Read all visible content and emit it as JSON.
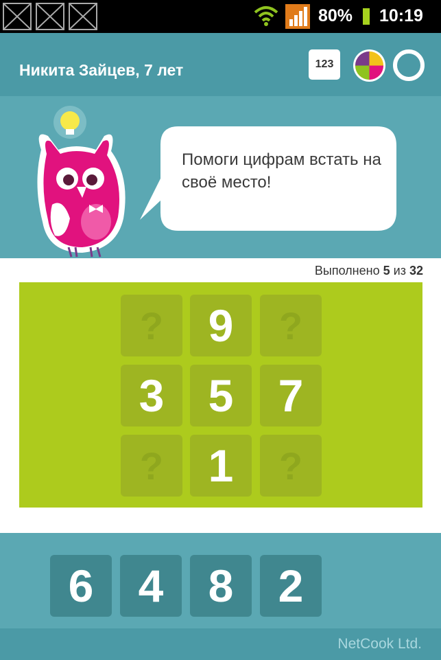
{
  "status_bar": {
    "battery": "80%",
    "time": "10:19"
  },
  "app_bar": {
    "profile_name": "Никита Зайцев, 7 лет",
    "numbers_button": "123"
  },
  "hero": {
    "speech": "Помоги цифрам встать на своё место!"
  },
  "progress": {
    "prefix": "Выполнено",
    "done": "5",
    "separator": "из",
    "total": "32"
  },
  "board": {
    "cells": [
      {
        "value": "?",
        "hidden": true
      },
      {
        "value": "9",
        "hidden": false
      },
      {
        "value": "?",
        "hidden": true
      },
      {
        "value": "3",
        "hidden": false
      },
      {
        "value": "5",
        "hidden": false
      },
      {
        "value": "7",
        "hidden": false
      },
      {
        "value": "?",
        "hidden": true
      },
      {
        "value": "1",
        "hidden": false
      },
      {
        "value": "?",
        "hidden": true
      }
    ]
  },
  "tray": {
    "tiles": [
      "6",
      "4",
      "8",
      "2"
    ]
  },
  "footer": {
    "brand": "NetCook Ltd."
  },
  "colors": {
    "board_bg": "#adcb1d",
    "teal": "#5ba8b3",
    "owl_pink": "#e1127e"
  }
}
